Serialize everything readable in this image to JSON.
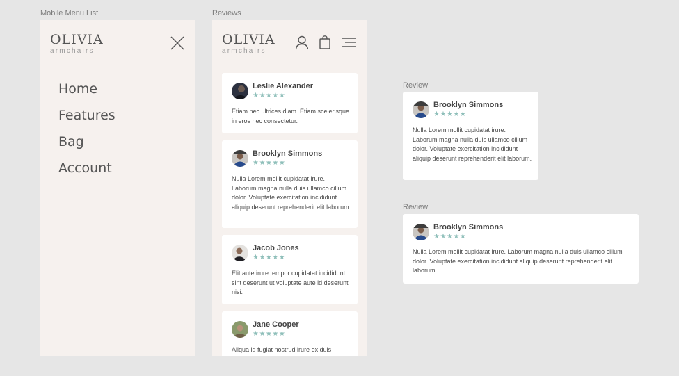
{
  "colors": {
    "background": "#e6e6e6",
    "phone_bg": "#f6f1ee",
    "card_bg": "#ffffff",
    "star": "#8fbfba"
  },
  "labels": {
    "mobile_menu": "Mobile Menu List",
    "reviews": "Reviews",
    "review_1": "Review",
    "review_2": "Review"
  },
  "brand": {
    "name": "OLIVIA",
    "sub": "armchairs"
  },
  "menu": {
    "items": [
      "Home",
      "Features",
      "Bag",
      "Account"
    ],
    "icons": {
      "close": "close-icon",
      "user": "user-icon",
      "bag": "bag-icon",
      "menu": "hamburger-menu-icon"
    }
  },
  "reviews": [
    {
      "name": "Leslie Alexander",
      "stars": "★★★★★",
      "rating": 5,
      "text": "Etiam nec ultrices diam. Etiam scelerisque in eros nec consectetur."
    },
    {
      "name": "Brooklyn Simmons",
      "stars": "★★★★★",
      "rating": 5,
      "text": "Nulla Lorem mollit cupidatat irure. Laborum magna nulla duis ullamco cillum dolor. Voluptate exercitation incididunt aliquip deserunt reprehenderit elit laborum."
    },
    {
      "name": "Jacob Jones",
      "stars": "★★★★★",
      "rating": 5,
      "text": "Elit aute irure tempor cupidatat incididunt sint deserunt ut voluptate aute id deserunt nisi."
    },
    {
      "name": "Jane Cooper",
      "stars": "★★★★★",
      "rating": 5,
      "text": "Aliqua id fugiat nostrud irure ex duis"
    }
  ],
  "review_single": {
    "name": "Brooklyn Simmons",
    "stars": "★★★★★",
    "rating": 5,
    "text": "Nulla Lorem mollit cupidatat irure. Laborum magna nulla duis ullamco cillum dolor. Voluptate exercitation incididunt aliquip deserunt reprehenderit elit laborum."
  },
  "review_wide": {
    "name": "Brooklyn Simmons",
    "stars": "★★★★★",
    "rating": 5,
    "text": "Nulla Lorem mollit cupidatat irure. Laborum magna nulla duis ullamco cillum dolor. Voluptate exercitation incididunt aliquip deserunt reprehenderit elit laborum."
  }
}
